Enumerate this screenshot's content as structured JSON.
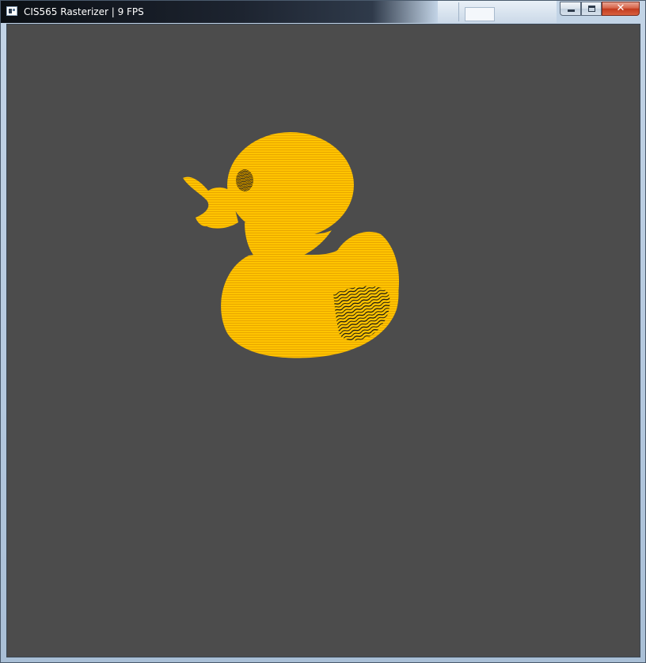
{
  "window": {
    "title": "CIS565 Rasterizer | 9 FPS",
    "icon": "app-window-icon",
    "caption_buttons": {
      "minimize_icon": "minimize-icon",
      "maximize_icon": "maximize-icon",
      "close_icon": "close-icon",
      "close_glyph": "✕"
    }
  },
  "viewport": {
    "background_color": "#4c4c4c",
    "model": {
      "name": "rubber-duck",
      "primary_color": "#ffc400",
      "stripe_color": "#e8a600",
      "artifact_color": "#111111"
    }
  }
}
